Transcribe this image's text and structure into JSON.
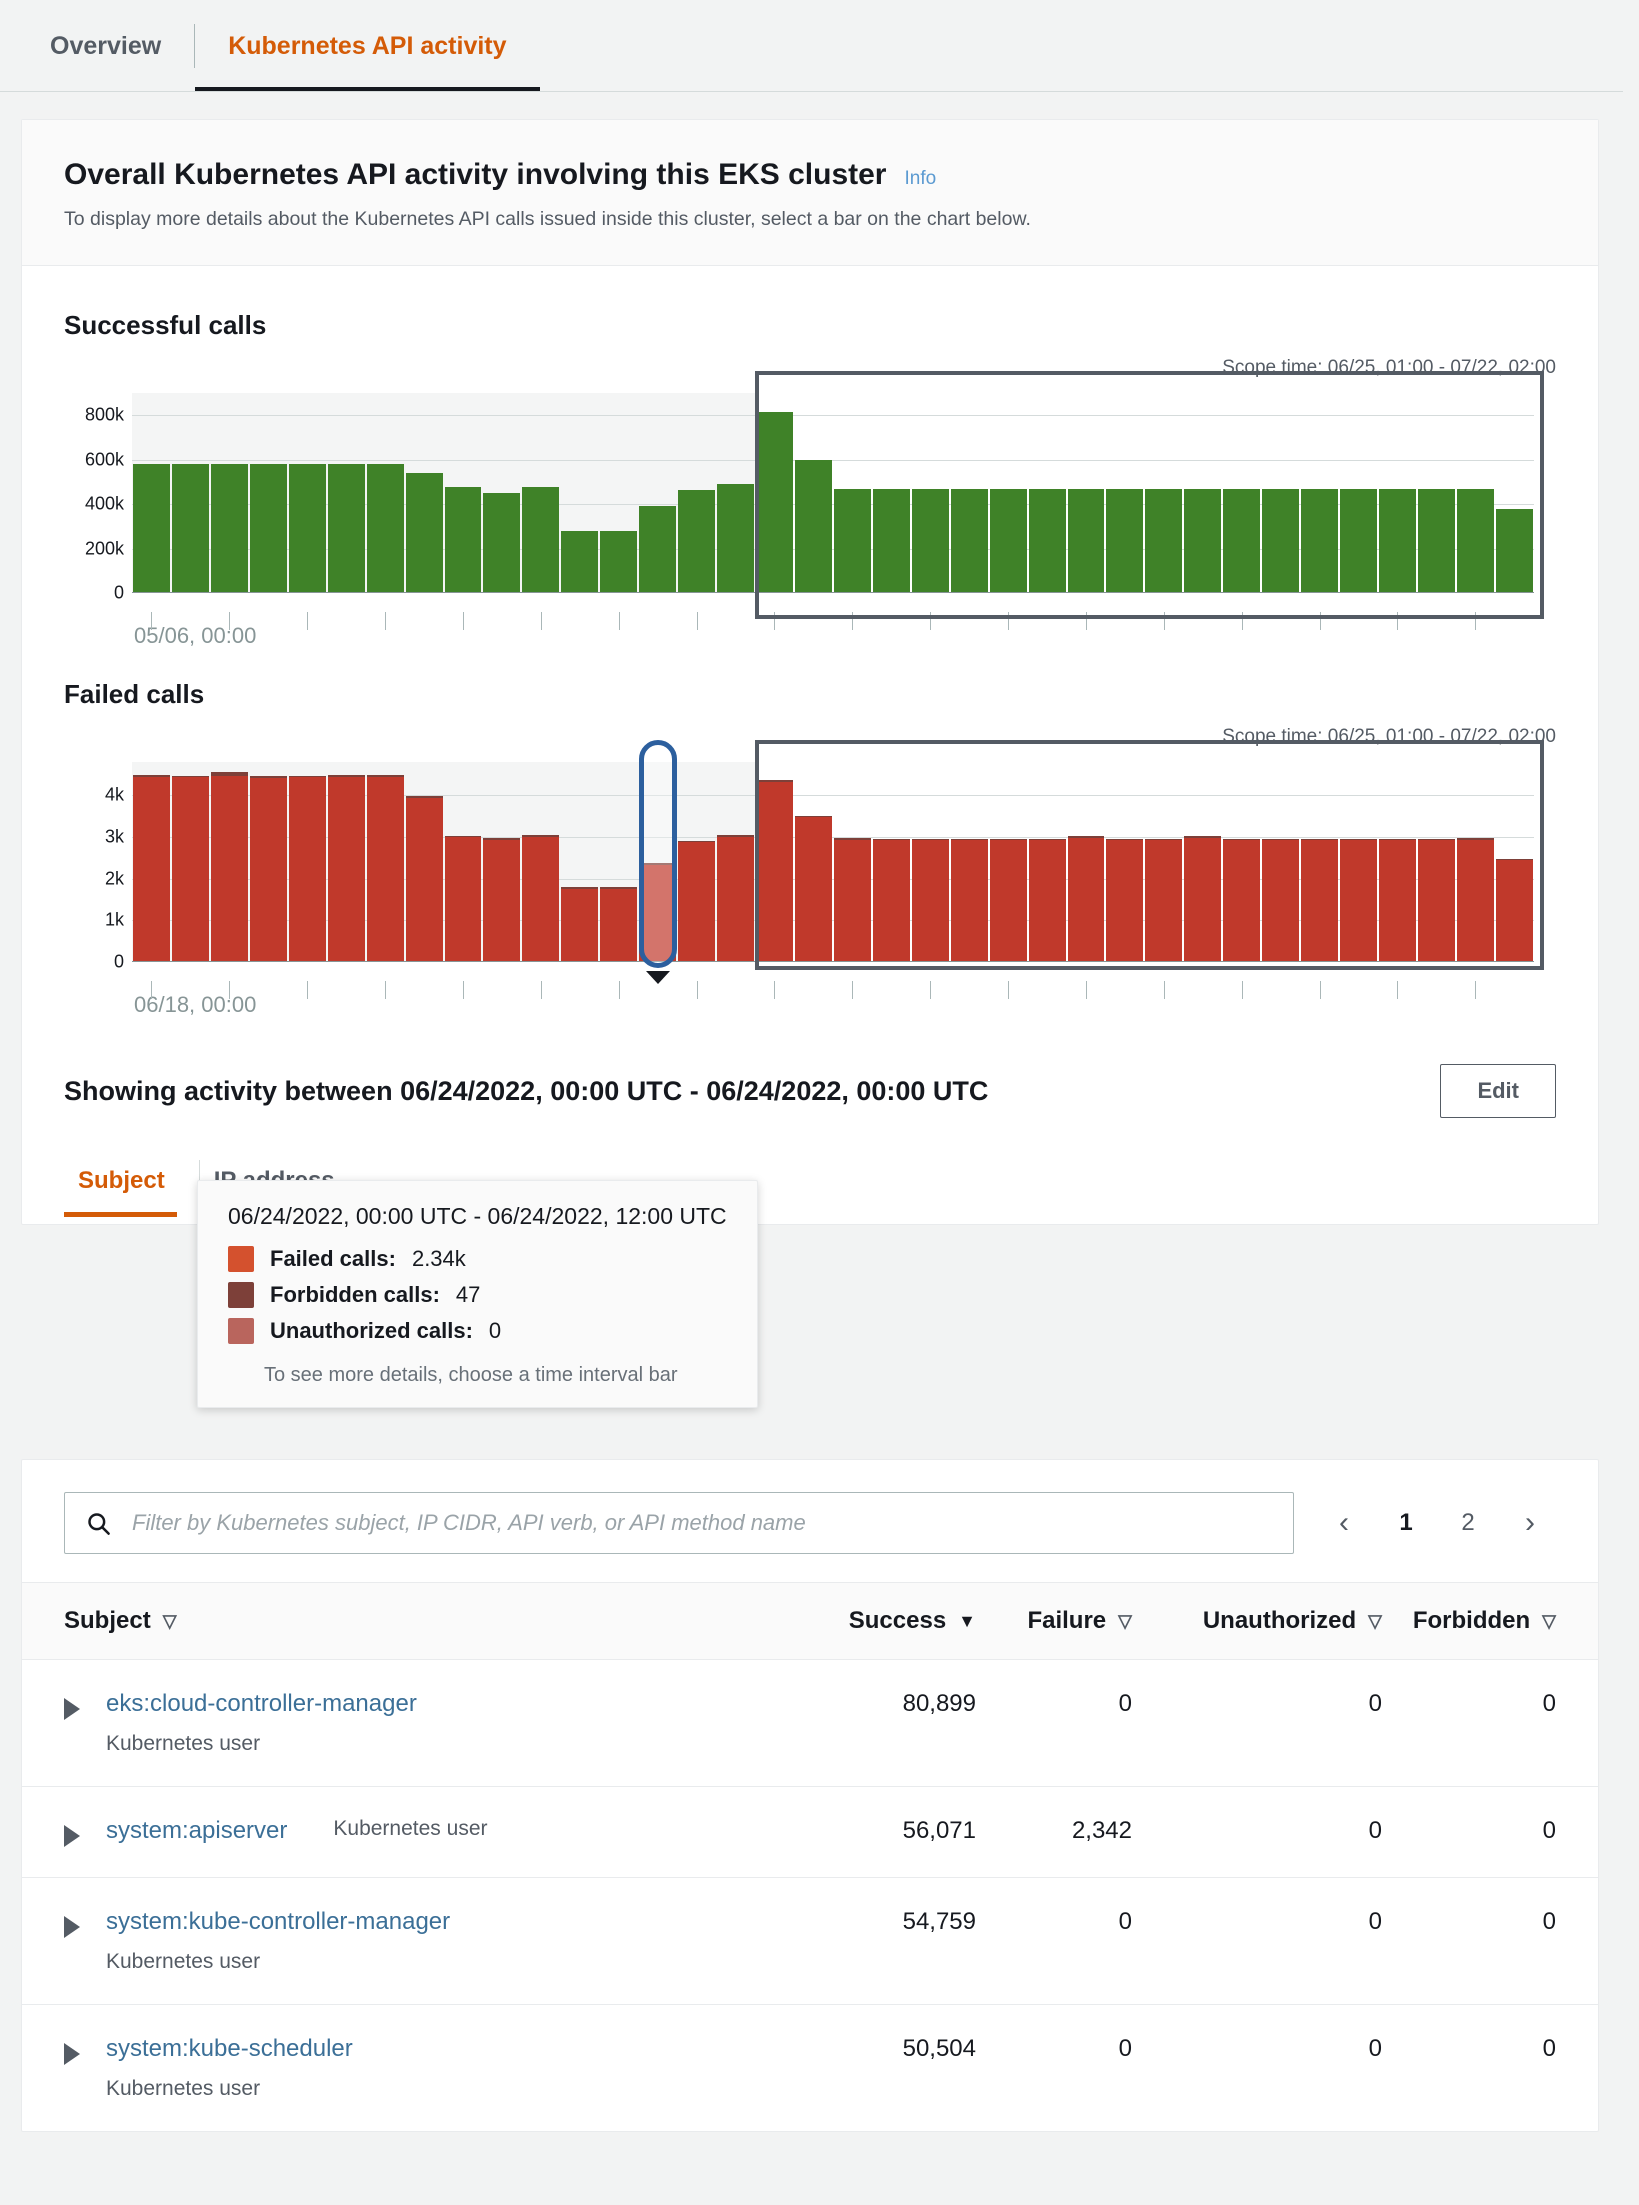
{
  "tabs": [
    {
      "label": "Overview",
      "active": false
    },
    {
      "label": "Kubernetes API activity",
      "active": true
    }
  ],
  "header": {
    "title": "Overall Kubernetes API activity involving this EKS cluster",
    "info_label": "Info",
    "subtitle": "To display more details about the Kubernetes API calls issued inside this cluster, select a bar on the chart below."
  },
  "charts": {
    "success": {
      "heading": "Successful calls",
      "scope_time": "Scope time: 06/25, 01:00 - 07/22, 02:00",
      "x_label": "05/06, 00:00"
    },
    "failed": {
      "heading": "Failed calls",
      "scope_time": "Scope time: 06/25, 01:00 - 07/22, 02:00",
      "x_label": "06/18, 00:00"
    }
  },
  "tooltip": {
    "title": "06/24/2022, 00:00 UTC - 06/24/2022, 12:00 UTC",
    "rows": [
      {
        "label": "Failed calls:",
        "value": "2.34k",
        "color": "#d4512e"
      },
      {
        "label": "Forbidden calls:",
        "value": "47",
        "color": "#7d4039"
      },
      {
        "label": "Unauthorized calls:",
        "value": "0",
        "color": "#b9655d"
      }
    ],
    "footer": "To see more details, choose a time interval bar"
  },
  "showing": {
    "text": "Showing activity between 06/24/2022, 00:00 UTC - 06/24/2022, 00:00 UTC",
    "edit_label": "Edit"
  },
  "subtabs": [
    {
      "label": "Subject",
      "active": true
    },
    {
      "label": "IP address",
      "active": false
    }
  ],
  "search": {
    "placeholder": "Filter by Kubernetes subject, IP CIDR, API verb, or API method name",
    "value": ""
  },
  "pagination": {
    "prev": "‹",
    "next": "›",
    "pages": [
      "1",
      "2"
    ],
    "current": "1"
  },
  "table": {
    "columns": [
      {
        "label": "Subject",
        "sort": "idle",
        "glyph": "▽"
      },
      {
        "label": "Success",
        "sort": "active",
        "glyph": "▼"
      },
      {
        "label": "Failure",
        "sort": "idle",
        "glyph": "▽"
      },
      {
        "label": "Unauthorized",
        "sort": "idle",
        "glyph": "▽"
      },
      {
        "label": "Forbidden",
        "sort": "idle",
        "glyph": "▽"
      }
    ],
    "rows": [
      {
        "subject": "eks:cloud-controller-manager",
        "kind": "Kubernetes user",
        "kind_inline": false,
        "success": "80,899",
        "failure": "0",
        "unauthorized": "0",
        "forbidden": "0"
      },
      {
        "subject": "system:apiserver",
        "kind": "Kubernetes user",
        "kind_inline": true,
        "success": "56,071",
        "failure": "2,342",
        "unauthorized": "0",
        "forbidden": "0"
      },
      {
        "subject": "system:kube-controller-manager",
        "kind": "Kubernetes user",
        "kind_inline": false,
        "success": "54,759",
        "failure": "0",
        "unauthorized": "0",
        "forbidden": "0"
      },
      {
        "subject": "system:kube-scheduler",
        "kind": "Kubernetes user",
        "kind_inline": false,
        "success": "50,504",
        "failure": "0",
        "unauthorized": "0",
        "forbidden": "0"
      }
    ]
  },
  "chart_data": [
    {
      "type": "bar",
      "title": "Successful calls",
      "xlabel": "05/06, 00:00",
      "ylabel": "",
      "ylim": [
        0,
        900000
      ],
      "yticks": [
        0,
        200000,
        400000,
        600000,
        800000
      ],
      "ytick_labels": [
        "0",
        "200k",
        "400k",
        "600k",
        "800k"
      ],
      "grid": true,
      "color": "#3f8228",
      "selection_start_index": 16,
      "values": [
        580000,
        580000,
        580000,
        580000,
        580000,
        580000,
        580000,
        540000,
        475000,
        450000,
        478000,
        278000,
        278000,
        390000,
        465000,
        490000,
        815000,
        600000,
        470000,
        470000,
        470000,
        470000,
        470000,
        470000,
        470000,
        470000,
        470000,
        470000,
        470000,
        470000,
        470000,
        470000,
        470000,
        470000,
        470000,
        380000
      ]
    },
    {
      "type": "bar",
      "title": "Failed calls",
      "xlabel": "06/18, 00:00",
      "ylabel": "",
      "ylim": [
        0,
        4800
      ],
      "yticks": [
        0,
        1000,
        2000,
        3000,
        4000
      ],
      "ytick_labels": [
        "0",
        "1k",
        "2k",
        "3k",
        "4k"
      ],
      "grid": true,
      "stacked": true,
      "series": [
        {
          "name": "Failed calls",
          "color": "#c0392b",
          "values": [
            4430,
            4430,
            4470,
            4420,
            4430,
            4430,
            4430,
            3940,
            2990,
            2930,
            2990,
            1760,
            1760,
            2340,
            2870,
            3010,
            4320,
            3470,
            2930,
            2920,
            2920,
            2920,
            2920,
            2920,
            2980,
            2920,
            2920,
            2980,
            2920,
            2920,
            2920,
            2920,
            2920,
            2920,
            2930,
            2450
          ]
        },
        {
          "name": "Forbidden calls",
          "color": "#7d4039",
          "values": [
            60,
            40,
            90,
            50,
            45,
            50,
            50,
            40,
            45,
            40,
            60,
            30,
            30,
            47,
            40,
            40,
            40,
            40,
            40,
            40,
            40,
            40,
            40,
            40,
            40,
            40,
            40,
            40,
            40,
            40,
            40,
            40,
            40,
            40,
            40,
            30
          ]
        },
        {
          "name": "Unauthorized calls",
          "color": "#b9655d",
          "values": [
            0,
            0,
            0,
            0,
            0,
            0,
            0,
            0,
            0,
            0,
            0,
            0,
            0,
            0,
            0,
            0,
            0,
            0,
            0,
            0,
            0,
            0,
            0,
            0,
            0,
            0,
            0,
            0,
            0,
            0,
            0,
            0,
            0,
            0,
            0,
            0
          ]
        }
      ],
      "selection_start_index": 16,
      "highlight_index": 13
    }
  ]
}
